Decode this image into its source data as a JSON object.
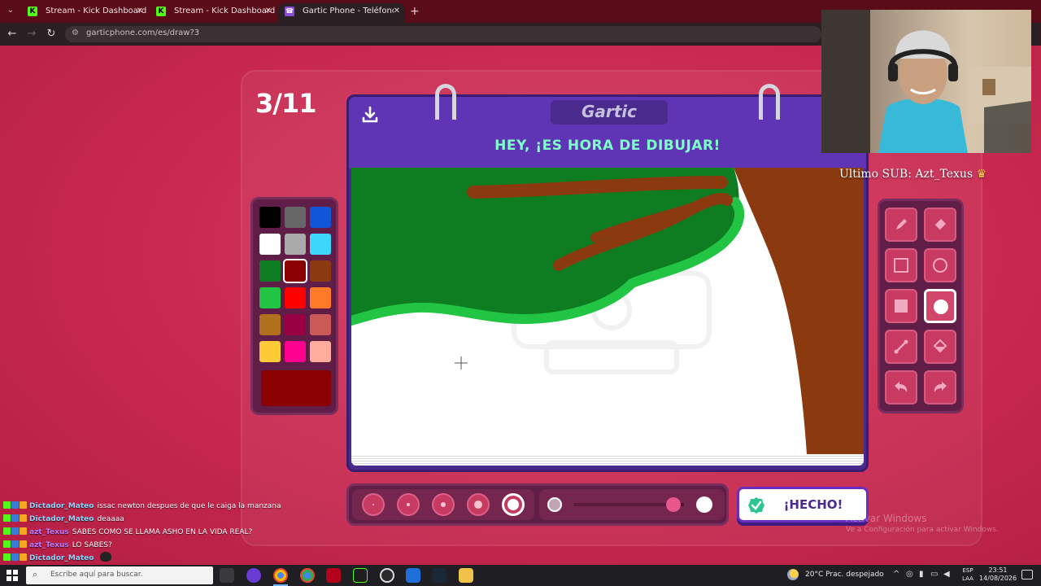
{
  "browser": {
    "tabs": [
      {
        "title": "Stream - Kick Dashboard",
        "favicon": "kick-icon",
        "active": false
      },
      {
        "title": "Stream - Kick Dashboard",
        "favicon": "kick-icon",
        "active": false
      },
      {
        "title": "Gartic Phone - Teléfono Descompuesto",
        "favicon": "gartic-icon",
        "active": true
      }
    ],
    "url": "garticphone.com/es/draw?3"
  },
  "game": {
    "round": "3/11",
    "logo": "Gartic",
    "prompt": "HEY, ¡ES HORA DE DIBUJAR!",
    "done_label": "¡HECHO!",
    "colors": {
      "palette": [
        "#000000",
        "#666666",
        "#1156d6",
        "#ffffff",
        "#aaaaaa",
        "#3dd7fb",
        "#0e7c21",
        "#8b0000",
        "#8b3a0f",
        "#22c443",
        "#ff0000",
        "#ff7a29",
        "#b0701c",
        "#990044",
        "#cb5a57",
        "#fec936",
        "#ff008f",
        "#fead9d"
      ],
      "selected_index": 7,
      "current": "#8b0000"
    },
    "tools": [
      "pencil-icon",
      "eraser-icon",
      "rectangle-outline-icon",
      "ellipse-outline-icon",
      "rectangle-fill-icon",
      "ellipse-fill-icon",
      "line-icon",
      "bucket-fill-icon",
      "undo-icon",
      "redo-icon"
    ],
    "active_tool_index": 5,
    "brush_sizes": 5,
    "active_brush_size_index": 4,
    "opacity": 0.97
  },
  "stream": {
    "last_sub": "Ultimo SUB: Azt_Texus"
  },
  "chat": [
    {
      "user": "Dictador_Mateo",
      "color": "u1",
      "message": "issac newton despues de que le caiga la manzana"
    },
    {
      "user": "Dictador_Mateo",
      "color": "u1",
      "message": "deaaaa"
    },
    {
      "user": "azt_Texus",
      "color": "u2",
      "message": "SABES COMO SE LLAMA ASHO EN LA VIDA REAL?"
    },
    {
      "user": "azt_Texus",
      "color": "u2",
      "message": "LO SABES?"
    },
    {
      "user": "Dictador_Mateo",
      "color": "u1",
      "message": ""
    }
  ],
  "watermark": {
    "line1": "Activar Windows",
    "line2": "Ve a Configuración para activar Windows."
  },
  "taskbar": {
    "search_placeholder": "Escribe aquí para buscar.",
    "weather": "20°C  Prac. despejado",
    "lang_top": "ESP",
    "lang_bottom": "LAA",
    "time": "23:51",
    "date": "14/08/2026"
  }
}
